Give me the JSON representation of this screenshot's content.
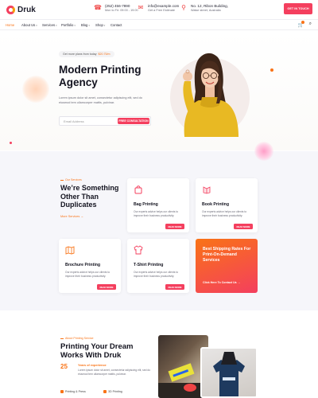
{
  "brand": {
    "name": "Druk"
  },
  "topbar": {
    "phone": {
      "main": "(252) 456-7890",
      "sub": "Mon to Fri: 09:00 - 19:00"
    },
    "email": {
      "main": "info@example.com",
      "sub": "Get a Free Estimate"
    },
    "address": {
      "main": "No. 12, Ribon Building,",
      "sub": "Walse street, Australia"
    },
    "cta_label": "GET IN TOUCH"
  },
  "nav": {
    "items": [
      {
        "label": "Home",
        "dropdown": false
      },
      {
        "label": "About Us",
        "dropdown": true
      },
      {
        "label": "Services",
        "dropdown": true
      },
      {
        "label": "Portfolio",
        "dropdown": true
      },
      {
        "label": "Blog",
        "dropdown": true
      },
      {
        "label": "Shop",
        "dropdown": true
      },
      {
        "label": "Contact",
        "dropdown": false
      }
    ]
  },
  "hero": {
    "tag_text": "Get more plans from today",
    "tag_price": "$20.75/m",
    "title_line1": "Modern Printing",
    "title_line2": "Agency",
    "subtitle_line1": "Lorem ipsum dolor sit amet, consectetur adipiscing elit, sed do",
    "subtitle_line2": "eiusmod tem ullamcorper mattis, pulvinar.",
    "email_placeholder": "Email Address",
    "email_button": "FREE CONSULTATION"
  },
  "services": {
    "tag": "Our Services",
    "title_line1": "We’re Something",
    "title_line2": "Other Than",
    "title_line3": "Duplicates",
    "more_link": "More Services",
    "cards": [
      {
        "name": "Bag Printing",
        "desc": "Our experts advice helps our clients to improve their business productivity.",
        "button": "READ MORE",
        "icon": "bag-icon"
      },
      {
        "name": "Book Printing",
        "desc": "Our experts advice helps our clients to improve their business productivity.",
        "button": "READ MORE",
        "icon": "book-icon"
      },
      {
        "name": "Brochure Printing",
        "desc": "Our experts advice helps our clients to improve their business productivity.",
        "button": "READ MORE",
        "icon": "brochure-icon"
      },
      {
        "name": "T-Shirt Printing",
        "desc": "Our experts advice helps our clients to improve their business productivity.",
        "button": "READ MORE",
        "icon": "tshirt-icon"
      }
    ],
    "promo": {
      "title": "Best Shipping Rates For Print-On-Demand Services",
      "link": "Click Here To Contact Us"
    }
  },
  "about": {
    "tag": "About Printing Service",
    "title_line1": "Printing Your Dream",
    "title_line2": "Works With Druk",
    "years_value": "25",
    "years_label": "Years of experience",
    "years_desc": "Lorem ipsum dolor sit amet, consectetur adipiscing elit, sed do eiusmod tem ullamcorper mattis, pulvinar.",
    "features": [
      "Printing & Press",
      "3D Printing"
    ]
  },
  "colors": {
    "accent": "#f43f5e",
    "accent_orange": "#f97316",
    "services_bg": "#f6f6fa"
  }
}
